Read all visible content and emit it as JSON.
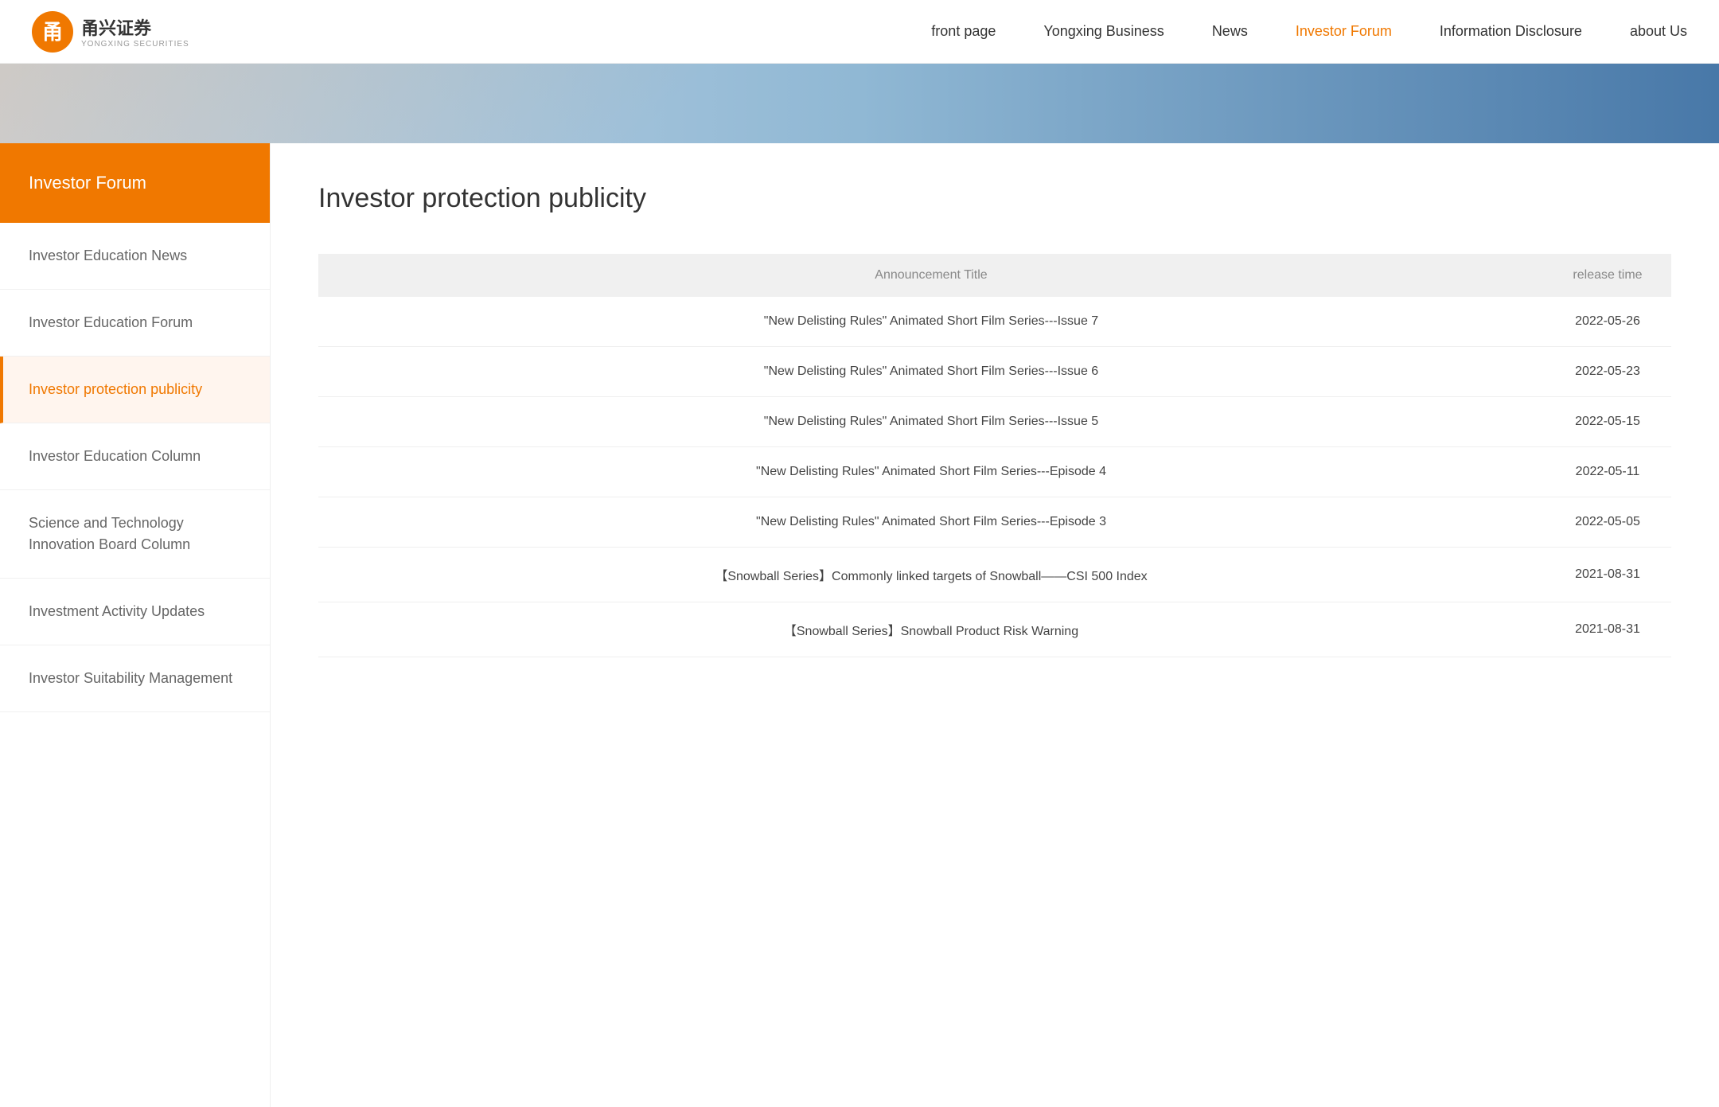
{
  "header": {
    "logo_cn": "甬兴证券",
    "logo_en": "YONGXING SECURITIES",
    "nav_items": [
      {
        "id": "front-page",
        "label": "front page",
        "active": false
      },
      {
        "id": "yongxing-business",
        "label": "Yongxing Business",
        "active": false
      },
      {
        "id": "news",
        "label": "News",
        "active": false
      },
      {
        "id": "investor-forum",
        "label": "Investor Forum",
        "active": true
      },
      {
        "id": "information-disclosure",
        "label": "Information Disclosure",
        "active": false
      },
      {
        "id": "about-us",
        "label": "about Us",
        "active": false
      }
    ]
  },
  "sidebar": {
    "header_label": "Investor Forum",
    "menu_items": [
      {
        "id": "investor-education-news",
        "label": "Investor Education News",
        "active": false
      },
      {
        "id": "investor-education-forum",
        "label": "Investor Education Forum",
        "active": false
      },
      {
        "id": "investor-protection-publicity",
        "label": "Investor protection publicity",
        "active": true
      },
      {
        "id": "investor-education-column",
        "label": "Investor Education Column",
        "active": false
      },
      {
        "id": "science-technology-board",
        "label": "Science and Technology Innovation Board Column",
        "active": false
      },
      {
        "id": "investment-activity-updates",
        "label": "Investment Activity Updates",
        "active": false
      },
      {
        "id": "investor-suitability-management",
        "label": "Investor Suitability Management",
        "active": false
      }
    ]
  },
  "content": {
    "page_title": "Investor protection publicity",
    "table": {
      "col_announcement": "Announcement Title",
      "col_release_time": "release time",
      "rows": [
        {
          "title": "\"New Delisting Rules\" Animated Short Film Series---Issue 7",
          "date": "2022-05-26"
        },
        {
          "title": "\"New Delisting Rules\" Animated Short Film Series---Issue 6",
          "date": "2022-05-23"
        },
        {
          "title": "\"New Delisting Rules\" Animated Short Film Series---Issue 5",
          "date": "2022-05-15"
        },
        {
          "title": "\"New Delisting Rules\" Animated Short Film Series---Episode 4",
          "date": "2022-05-11"
        },
        {
          "title": "\"New Delisting Rules\" Animated Short Film Series---Episode 3",
          "date": "2022-05-05"
        },
        {
          "title": "【Snowball Series】Commonly linked targets of Snowball——CSI 500 Index",
          "date": "2021-08-31"
        },
        {
          "title": "【Snowball Series】Snowball Product Risk Warning",
          "date": "2021-08-31"
        }
      ]
    }
  }
}
